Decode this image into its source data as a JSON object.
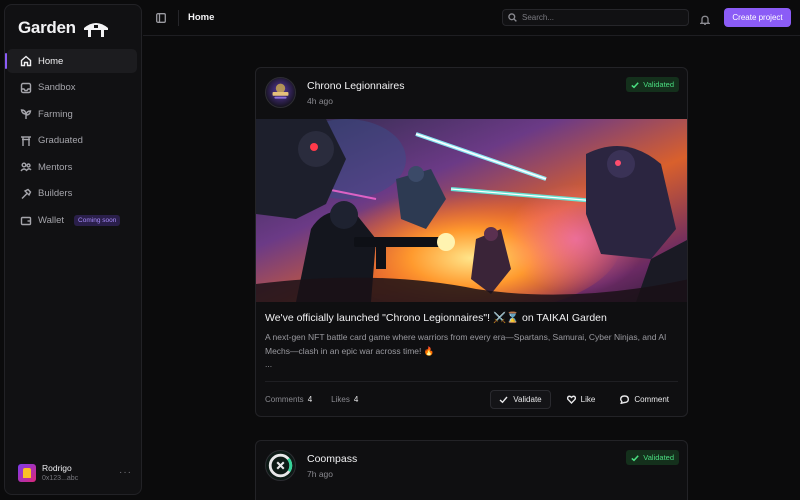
{
  "brand": {
    "name": "Garden"
  },
  "sidebar": {
    "items": [
      {
        "label": "Home",
        "icon": "home-icon"
      },
      {
        "label": "Sandbox",
        "icon": "inbox-icon"
      },
      {
        "label": "Farming",
        "icon": "sprout-icon"
      },
      {
        "label": "Graduated",
        "icon": "torii-gate-icon"
      },
      {
        "label": "Mentors",
        "icon": "users-icon"
      },
      {
        "label": "Builders",
        "icon": "hammer-icon"
      },
      {
        "label": "Wallet",
        "icon": "wallet-icon",
        "badge": "Coming soon"
      }
    ],
    "user": {
      "name": "Rodrigo",
      "address": "0x123...abc",
      "more": "···"
    }
  },
  "header": {
    "title": "Home",
    "search_placeholder": "Search...",
    "create_label": "Create project"
  },
  "posts": [
    {
      "project": "Chrono Legionnaires",
      "time": "4h ago",
      "badge": "Validated",
      "title": "We've officially launched \"Chrono Legionnaires\"! ⚔️⌛ on TAIKAI Garden",
      "description": "A next-gen NFT battle card game where warriors from every era—Spartans, Samurai, Cyber Ninjas, and AI Mechs—clash in an epic war across time! 🔥",
      "ellipsis": "...",
      "comments_label": "Comments",
      "comments_count": "4",
      "likes_label": "Likes",
      "likes_count": "4",
      "validate_label": "Validate",
      "like_label": "Like",
      "comment_label": "Comment"
    },
    {
      "project": "Coompass",
      "time": "7h ago",
      "badge": "Validated"
    }
  ],
  "colors": {
    "accent": "#8b5cf6",
    "validated": "#4ade80",
    "background": "#0b0b0c"
  }
}
